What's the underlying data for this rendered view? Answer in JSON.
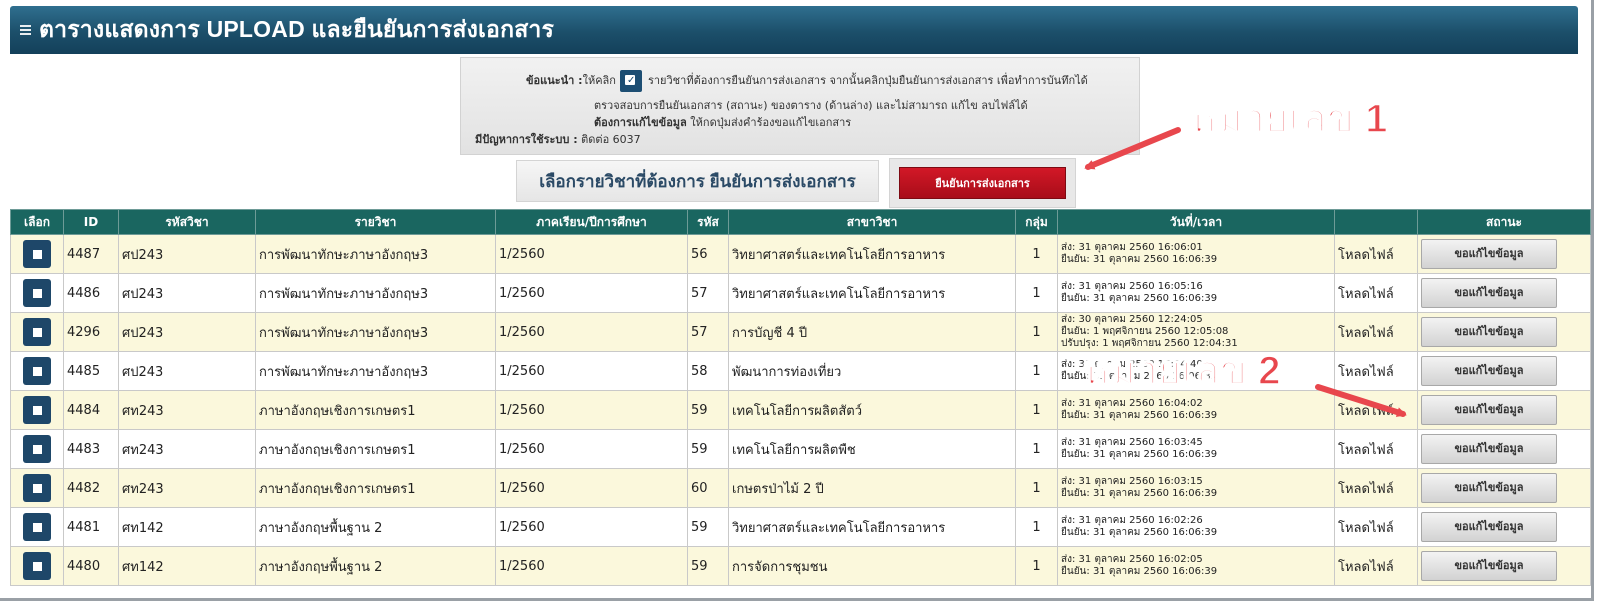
{
  "page": {
    "title": "ตารางแสดงการ UPLOAD และยืนยันการส่งเอกสาร"
  },
  "hint": {
    "label": "ข้อแนะนำ :",
    "line1_a": "ให้คลิก",
    "line1_b": "รายวิชาที่ต้องการยืนยันการส่งเอกสาร จากนั้นคลิกปุ่มยืนยันการส่งเอกสาร เพื่อทำการบันทึกได้",
    "line2": "ตรวจสอบการยืนยันเอกสาร (สถานะ) ของตาราง (ด้านล่าง)  และไม่สามารถ แก้ไข ลบไฟล์ได้",
    "line3_bold": "ต้องการแก้ไขข้อมูล",
    "line3_rest": " ให้กดปุ่มส่งคำร้องขอแก้ไขเอกสาร",
    "line4_bold": "มีปัญหาการใช้ระบบ :",
    "line4_rest": " ติดต่อ 6037",
    "check_icon": "checkbox-icon"
  },
  "actions": {
    "select_label": "เลือกรายวิชาที่ต้องการ ยืนยันการส่งเอกสาร",
    "confirm_button": "ยืนยันการส่งเอกสาร"
  },
  "annotations": {
    "label1": "หมายเลข 1",
    "label2": "หมายเลข 2",
    "color": "#e8474d"
  },
  "table": {
    "headers": {
      "select": "เลือก",
      "id": "ID",
      "code": "รหัสวิชา",
      "course": "รายวิชา",
      "term": "ภาคเรียน/ปีการศึกษา",
      "section_code": "รหัส",
      "major": "สาขาวิชา",
      "group": "กลุ่ม",
      "datetime": "วันที่/เวลา",
      "file": "",
      "status": "สถานะ"
    },
    "rows": [
      {
        "id": "4487",
        "code": "ศป243",
        "course": "การพัฒนาทักษะภาษาอังกฤษ3",
        "term": "1/2560",
        "sec": "56",
        "major": "วิทยาศาสตร์และเทคโนโลยีการอาหาร",
        "group": "1",
        "dt1": "ส่ง: 31 ตุลาคม 2560 16:06:01",
        "dt2": "ยืนยัน: 31 ตุลาคม 2560 16:06:39",
        "dt3": "",
        "file": "โหลดไฟล์",
        "btn": "ขอแก้ไขข้อมูล"
      },
      {
        "id": "4486",
        "code": "ศป243",
        "course": "การพัฒนาทักษะภาษาอังกฤษ3",
        "term": "1/2560",
        "sec": "57",
        "major": "วิทยาศาสตร์และเทคโนโลยีการอาหาร",
        "group": "1",
        "dt1": "ส่ง: 31 ตุลาคม 2560 16:05:16",
        "dt2": "ยืนยัน: 31 ตุลาคม 2560 16:06:39",
        "dt3": "",
        "file": "โหลดไฟล์",
        "btn": "ขอแก้ไขข้อมูล"
      },
      {
        "id": "4296",
        "code": "ศป243",
        "course": "การพัฒนาทักษะภาษาอังกฤษ3",
        "term": "1/2560",
        "sec": "57",
        "major": "การบัญชี 4 ปี",
        "group": "1",
        "dt1": "ส่ง: 30 ตุลาคม 2560 12:24:05",
        "dt2": "ยืนยัน: 1 พฤศจิกายน 2560 12:05:08",
        "dt3": "ปรับปรุง: 1 พฤศจิกายน 2560 12:04:31",
        "file": "โหลดไฟล์",
        "btn": "ขอแก้ไขข้อมูล"
      },
      {
        "id": "4485",
        "code": "ศป243",
        "course": "การพัฒนาทักษะภาษาอังกฤษ3",
        "term": "1/2560",
        "sec": "58",
        "major": "พัฒนาการท่องเที่ยว",
        "group": "1",
        "dt1": "ส่ง: 31 ตุลาคม 2560 16:04:40",
        "dt2": "ยืนยัน: 31 ตุลาคม 2560 16:06:39",
        "dt3": "",
        "file": "โหลดไฟล์",
        "btn": "ขอแก้ไขข้อมูล"
      },
      {
        "id": "4484",
        "code": "ศท243",
        "course": "ภาษาอังกฤษเชิงการเกษตร1",
        "term": "1/2560",
        "sec": "59",
        "major": "เทคโนโลยีการผลิตสัตว์",
        "group": "1",
        "dt1": "ส่ง: 31 ตุลาคม 2560 16:04:02",
        "dt2": "ยืนยัน: 31 ตุลาคม 2560 16:06:39",
        "dt3": "",
        "file": "โหลดไฟล์",
        "btn": "ขอแก้ไขข้อมูล"
      },
      {
        "id": "4483",
        "code": "ศท243",
        "course": "ภาษาอังกฤษเชิงการเกษตร1",
        "term": "1/2560",
        "sec": "59",
        "major": "เทคโนโลยีการผลิตพืช",
        "group": "1",
        "dt1": "ส่ง: 31 ตุลาคม 2560 16:03:45",
        "dt2": "ยืนยัน: 31 ตุลาคม 2560 16:06:39",
        "dt3": "",
        "file": "โหลดไฟล์",
        "btn": "ขอแก้ไขข้อมูล"
      },
      {
        "id": "4482",
        "code": "ศท243",
        "course": "ภาษาอังกฤษเชิงการเกษตร1",
        "term": "1/2560",
        "sec": "60",
        "major": "เกษตรป่าไม้ 2 ปี",
        "group": "1",
        "dt1": "ส่ง: 31 ตุลาคม 2560 16:03:15",
        "dt2": "ยืนยัน: 31 ตุลาคม 2560 16:06:39",
        "dt3": "",
        "file": "โหลดไฟล์",
        "btn": "ขอแก้ไขข้อมูล"
      },
      {
        "id": "4481",
        "code": "ศท142",
        "course": "ภาษาอังกฤษพื้นฐาน 2",
        "term": "1/2560",
        "sec": "59",
        "major": "วิทยาศาสตร์และเทคโนโลยีการอาหาร",
        "group": "1",
        "dt1": "ส่ง: 31 ตุลาคม 2560 16:02:26",
        "dt2": "ยืนยัน: 31 ตุลาคม 2560 16:06:39",
        "dt3": "",
        "file": "โหลดไฟล์",
        "btn": "ขอแก้ไขข้อมูล"
      },
      {
        "id": "4480",
        "code": "ศท142",
        "course": "ภาษาอังกฤษพื้นฐาน 2",
        "term": "1/2560",
        "sec": "59",
        "major": "การจัดการชุมชน",
        "group": "1",
        "dt1": "ส่ง: 31 ตุลาคม 2560 16:02:05",
        "dt2": "ยืนยัน: 31 ตุลาคม 2560 16:06:39",
        "dt3": "",
        "file": "โหลดไฟล์",
        "btn": "ขอแก้ไขข้อมูล"
      }
    ]
  }
}
